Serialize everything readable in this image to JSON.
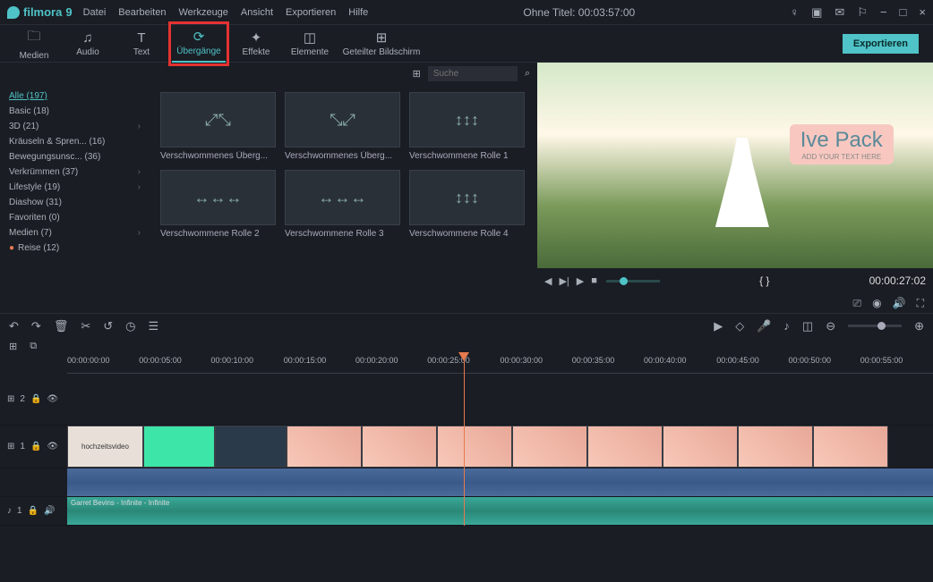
{
  "app": {
    "name": "filmora",
    "version": "9"
  },
  "menu": [
    "Datei",
    "Bearbeiten",
    "Werkzeuge",
    "Ansicht",
    "Exportieren",
    "Hilfe"
  ],
  "title": "Ohne Titel:  00:03:57:00",
  "window_controls": [
    "−",
    "□",
    "×"
  ],
  "tabs": [
    {
      "id": "medien",
      "label": "Medien",
      "icon": "folder"
    },
    {
      "id": "audio",
      "label": "Audio",
      "icon": "audio"
    },
    {
      "id": "text",
      "label": "Text",
      "icon": "text"
    },
    {
      "id": "uebergaenge",
      "label": "Übergänge",
      "icon": "transition",
      "active": true,
      "highlighted": true
    },
    {
      "id": "effekte",
      "label": "Effekte",
      "icon": "sparkle"
    },
    {
      "id": "elemente",
      "label": "Elemente",
      "icon": "elements"
    },
    {
      "id": "geteilter",
      "label": "Geteilter Bildschirm",
      "icon": "split"
    }
  ],
  "export_button": "Exportieren",
  "sidebar": [
    {
      "label": "Alle (197)",
      "active": true
    },
    {
      "label": "Basic (18)"
    },
    {
      "label": "3D (21)",
      "chevron": true
    },
    {
      "label": "Kräuseln & Spren... (16)"
    },
    {
      "label": "Bewegungsunsc... (36)"
    },
    {
      "label": "Verkrümmen (37)",
      "chevron": true
    },
    {
      "label": "Lifestyle (19)",
      "chevron": true
    },
    {
      "label": "Diashow (31)"
    },
    {
      "label": "Favoriten (0)"
    },
    {
      "label": "Medien (7)",
      "chevron": true
    },
    {
      "label": "Reise (12)",
      "dot": true
    }
  ],
  "search": {
    "placeholder": "Suche"
  },
  "transitions": [
    "Verschwommenes Überg...",
    "Verschwommenes Überg...",
    "Verschwommene Rolle 1",
    "Verschwommene Rolle 2",
    "Verschwommene Rolle 3",
    "Verschwommene Rolle 4"
  ],
  "preview": {
    "overlay_title": "Ive Pack",
    "overlay_sub": "ADD YOUR TEXT HERE",
    "timecode": "00:00:27:02",
    "braces": "{  }"
  },
  "ruler_marks": [
    "00:00:00:00",
    "00:00:05:00",
    "00:00:10:00",
    "00:00:15:00",
    "00:00:20:00",
    "00:00:25:00",
    "00:00:30:00",
    "00:00:35:00",
    "00:00:40:00",
    "00:00:45:00",
    "00:00:50:00",
    "00:00:55:00"
  ],
  "tracks": {
    "overlay": {
      "label": "2"
    },
    "video": {
      "label": "1",
      "clip_text": "hochzeitsvideo"
    },
    "audio1": {
      "label": "1"
    },
    "audio2": {
      "label": "1",
      "text": "Garret Bevins - Infinite - Infinite"
    }
  }
}
